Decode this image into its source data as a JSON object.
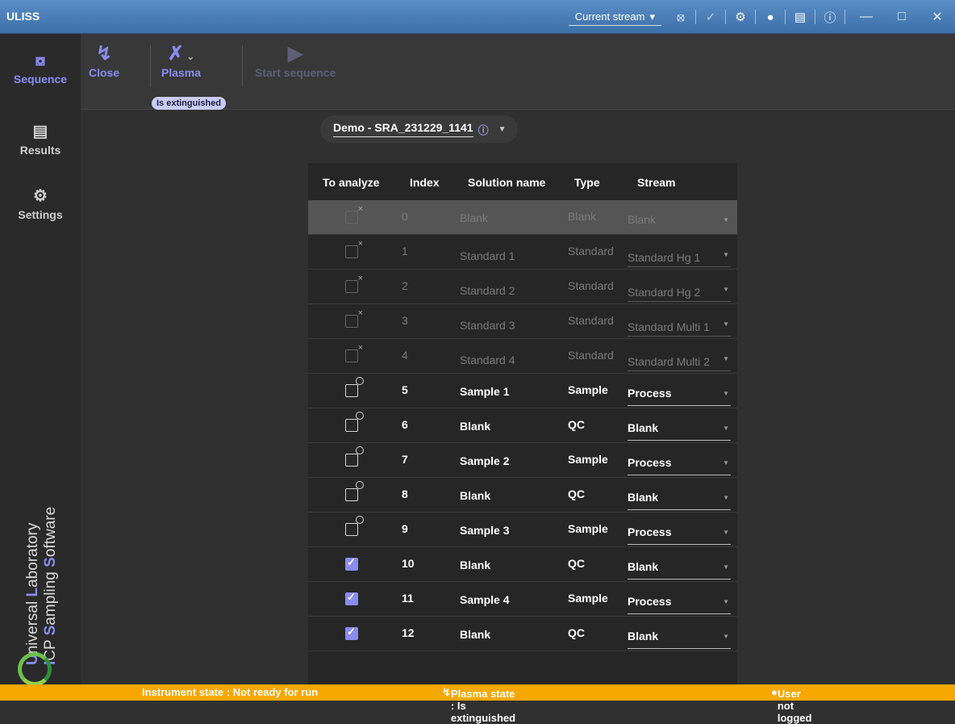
{
  "window": {
    "title": "ULISS"
  },
  "titlebar": {
    "stream_label": "Current stream"
  },
  "sidebar": {
    "items": [
      {
        "label": "Sequence",
        "icon": "sequence-icon"
      },
      {
        "label": "Results",
        "icon": "results-icon"
      },
      {
        "label": "Settings",
        "icon": "settings-icon"
      }
    ],
    "tagline": [
      {
        "initial": "U",
        "rest": "niversal "
      },
      {
        "initial": "L",
        "rest": "aboratory"
      },
      {
        "initial": "I",
        "rest": "CP "
      },
      {
        "initial": "S",
        "rest": "ampling "
      },
      {
        "initial": "S",
        "rest": "oftware"
      }
    ]
  },
  "toolbar": {
    "close_label": "Close",
    "plasma_label": "Plasma",
    "plasma_badge": "Is extinguished",
    "start_label": "Start sequence"
  },
  "sequence": {
    "name": "Demo - SRA_231229_1141"
  },
  "table": {
    "headers": [
      "To analyze",
      "Index",
      "Solution name",
      "Type",
      "Stream"
    ],
    "rows": [
      {
        "state": "off",
        "index": "0",
        "name": "Blank",
        "type": "Blank",
        "stream": "Blank",
        "style": "dim"
      },
      {
        "state": "off",
        "index": "1",
        "name": "Standard 1",
        "type": "Standard",
        "stream": "Standard Hg 1",
        "style": "dim"
      },
      {
        "state": "off",
        "index": "2",
        "name": "Standard 2",
        "type": "Standard",
        "stream": "Standard Hg 2",
        "style": "dim"
      },
      {
        "state": "off",
        "index": "3",
        "name": "Standard 3",
        "type": "Standard",
        "stream": "Standard Multi 1",
        "style": "dim"
      },
      {
        "state": "off",
        "index": "4",
        "name": "Standard 4",
        "type": "Standard",
        "stream": "Standard Multi 2",
        "style": "dim"
      },
      {
        "state": "clock",
        "index": "5",
        "name": "Sample 1",
        "type": "Sample",
        "stream": "Process",
        "style": "bold"
      },
      {
        "state": "clock",
        "index": "6",
        "name": "Blank",
        "type": "QC",
        "stream": "Blank",
        "style": "bold"
      },
      {
        "state": "clock",
        "index": "7",
        "name": "Sample 2",
        "type": "Sample",
        "stream": "Process",
        "style": "bold"
      },
      {
        "state": "clock",
        "index": "8",
        "name": "Blank",
        "type": "QC",
        "stream": "Blank",
        "style": "bold"
      },
      {
        "state": "clock",
        "index": "9",
        "name": "Sample 3",
        "type": "Sample",
        "stream": "Process",
        "style": "bold"
      },
      {
        "state": "on",
        "index": "10",
        "name": "Blank",
        "type": "QC",
        "stream": "Blank",
        "style": "bold"
      },
      {
        "state": "on",
        "index": "11",
        "name": "Sample 4",
        "type": "Sample",
        "stream": "Process",
        "style": "bold"
      },
      {
        "state": "on",
        "index": "12",
        "name": "Blank",
        "type": "QC",
        "stream": "Blank",
        "style": "bold"
      }
    ]
  },
  "status": {
    "instrument": "Instrument state : Not ready for run",
    "plasma": "Plasma state : Is extinguished",
    "user": "User not logged"
  },
  "colors": {
    "accent": "#8a8cf0",
    "status_bar": "#f7a800",
    "titlebar": "#4a7fba"
  }
}
